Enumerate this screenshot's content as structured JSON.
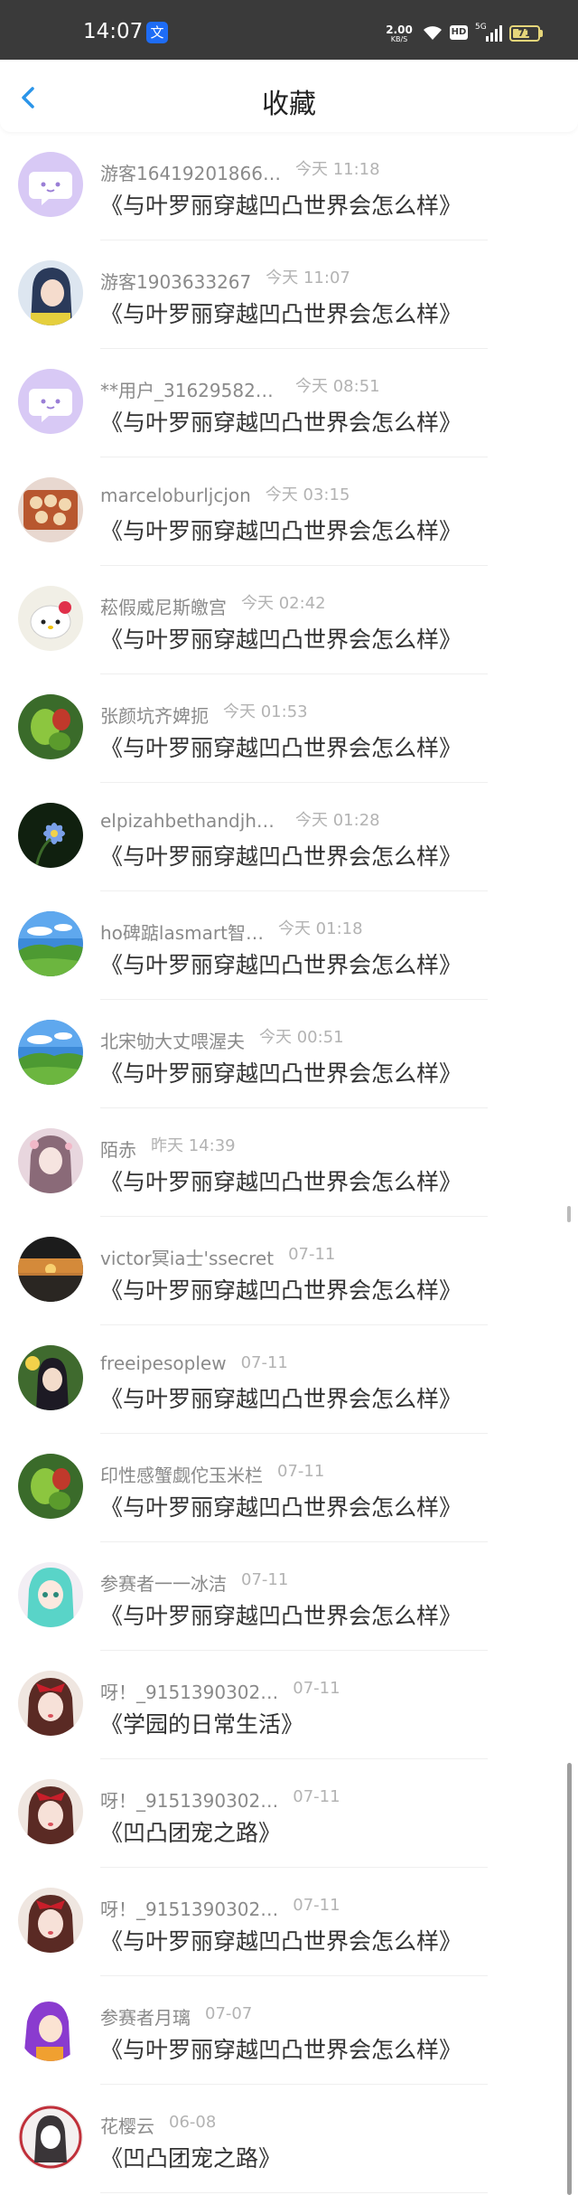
{
  "status_bar": {
    "time": "14:07",
    "app_icon": "translate-icon",
    "net_speed": "2.00",
    "net_speed_unit": "KB/S",
    "hd": "HD",
    "network": "5G",
    "battery": "71",
    "battery_level": 0.71
  },
  "header": {
    "back_icon": "chevron-left-icon",
    "title": "收藏",
    "accent_color": "#2b95e9"
  },
  "items": [
    {
      "username": "游客16419201866…",
      "time": "今天 11:18",
      "title": "《与叶罗丽穿越凹凸世界会怎么样》",
      "avatar": "chat-bubble-face"
    },
    {
      "username": "游客1903633267",
      "time": "今天 11:07",
      "title": "《与叶罗丽穿越凹凸世界会怎么样》",
      "avatar": "anime-girl"
    },
    {
      "username": "**用户_316295820…",
      "time": "今天 08:51",
      "title": "《与叶罗丽穿越凹凸世界会怎么样》",
      "avatar": "chat-bubble-face"
    },
    {
      "username": "marceloburljcjon",
      "time": "今天 03:15",
      "title": "《与叶罗丽穿越凹凸世界会怎么样》",
      "avatar": "food"
    },
    {
      "username": "菘假威尼斯皦宫",
      "time": "今天 02:42",
      "title": "《与叶罗丽穿越凹凸世界会怎么样》",
      "avatar": "hello-kitty"
    },
    {
      "username": "张颜坑齐婢扼",
      "time": "今天 01:53",
      "title": "《与叶罗丽穿越凹凸世界会怎么样》",
      "avatar": "green-fruit"
    },
    {
      "username": "elpizahbethandjha…",
      "time": "今天 01:28",
      "title": "《与叶罗丽穿越凹凸世界会怎么样》",
      "avatar": "blue-flower"
    },
    {
      "username": "ho碑踮lasmart智…",
      "time": "今天 01:18",
      "title": "《与叶罗丽穿越凹凸世界会怎么样》",
      "avatar": "landscape"
    },
    {
      "username": "北宋劬大丈喂渥夫",
      "time": "今天 00:51",
      "title": "《与叶罗丽穿越凹凸世界会怎么样》",
      "avatar": "landscape"
    },
    {
      "username": "陌赤",
      "time": "昨天 14:39",
      "title": "《与叶罗丽穿越凹凸世界会怎么样》",
      "avatar": "anime-girl-pink"
    },
    {
      "username": "victor冥ia士'ssecret",
      "time": "07-11",
      "title": "《与叶罗丽穿越凹凸世界会怎么样》",
      "avatar": "sunset"
    },
    {
      "username": "freeipesoplew",
      "time": "07-11",
      "title": "《与叶罗丽穿越凹凸世界会怎么样》",
      "avatar": "anime-girl-dark"
    },
    {
      "username": "印性感蟹觑佗玉米栏",
      "time": "07-11",
      "title": "《与叶罗丽穿越凹凸世界会怎么样》",
      "avatar": "green-fruit"
    },
    {
      "username": "参赛者一一冰洁",
      "time": "07-11",
      "title": "《与叶罗丽穿越凹凸世界会怎么样》",
      "avatar": "anime-girl-teal"
    },
    {
      "username": "呀！_9151390302…",
      "time": "07-11",
      "title": "《学园的日常生活》",
      "avatar": "anime-girl-red"
    },
    {
      "username": "呀！_9151390302…",
      "time": "07-11",
      "title": "《凹凸团宠之路》",
      "avatar": "anime-girl-red"
    },
    {
      "username": "呀！_9151390302…",
      "time": "07-11",
      "title": "《与叶罗丽穿越凹凸世界会怎么样》",
      "avatar": "anime-girl-red"
    },
    {
      "username": "参赛者月璃",
      "time": "07-07",
      "title": "《与叶罗丽穿越凹凸世界会怎么样》",
      "avatar": "anime-girl-purple"
    },
    {
      "username": "花樱云",
      "time": "06-08",
      "title": "《凹凸团宠之路》",
      "avatar": "anime-girl-sketch"
    }
  ]
}
